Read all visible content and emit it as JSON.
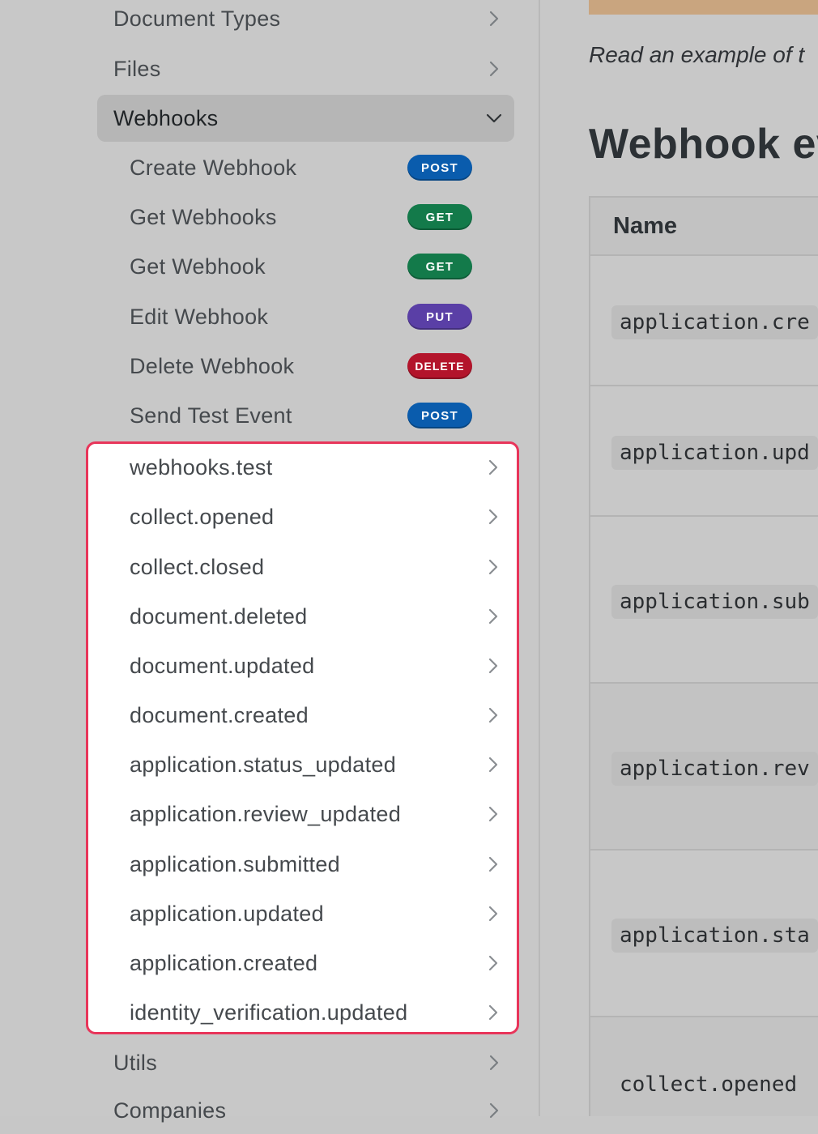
{
  "sidebar": {
    "top_items": [
      {
        "label": "Document Types"
      },
      {
        "label": "Files"
      },
      {
        "label": "Webhooks"
      }
    ],
    "webhook_endpoints": [
      {
        "label": "Create Webhook",
        "method": "POST"
      },
      {
        "label": "Get Webhooks",
        "method": "GET"
      },
      {
        "label": "Get Webhook",
        "method": "GET"
      },
      {
        "label": "Edit Webhook",
        "method": "PUT"
      },
      {
        "label": "Delete Webhook",
        "method": "DELETE"
      },
      {
        "label": "Send Test Event",
        "method": "POST"
      }
    ],
    "events": [
      {
        "label": "webhooks.test"
      },
      {
        "label": "collect.opened"
      },
      {
        "label": "collect.closed"
      },
      {
        "label": "document.deleted"
      },
      {
        "label": "document.updated"
      },
      {
        "label": "document.created"
      },
      {
        "label": "application.status_updated"
      },
      {
        "label": "application.review_updated"
      },
      {
        "label": "application.submitted"
      },
      {
        "label": "application.updated"
      },
      {
        "label": "application.created"
      },
      {
        "label": "identity_verification.updated"
      }
    ],
    "bottom_items": [
      {
        "label": "Utils"
      },
      {
        "label": "Companies"
      }
    ]
  },
  "method_colors": {
    "POST": "#0a5cad",
    "GET": "#137a4a",
    "PUT": "#5a3fa6",
    "DELETE": "#b3142b"
  },
  "highlight_color": "#e8355a",
  "main": {
    "intro_text": "Read an example of t",
    "heading": "Webhook ev",
    "table_header": "Name",
    "rows": [
      {
        "code": "application.cre"
      },
      {
        "code": "application.upd"
      },
      {
        "code": "application.sub"
      },
      {
        "code": "application.rev"
      },
      {
        "code": "application.sta"
      },
      {
        "code": "collect.opened"
      }
    ]
  }
}
